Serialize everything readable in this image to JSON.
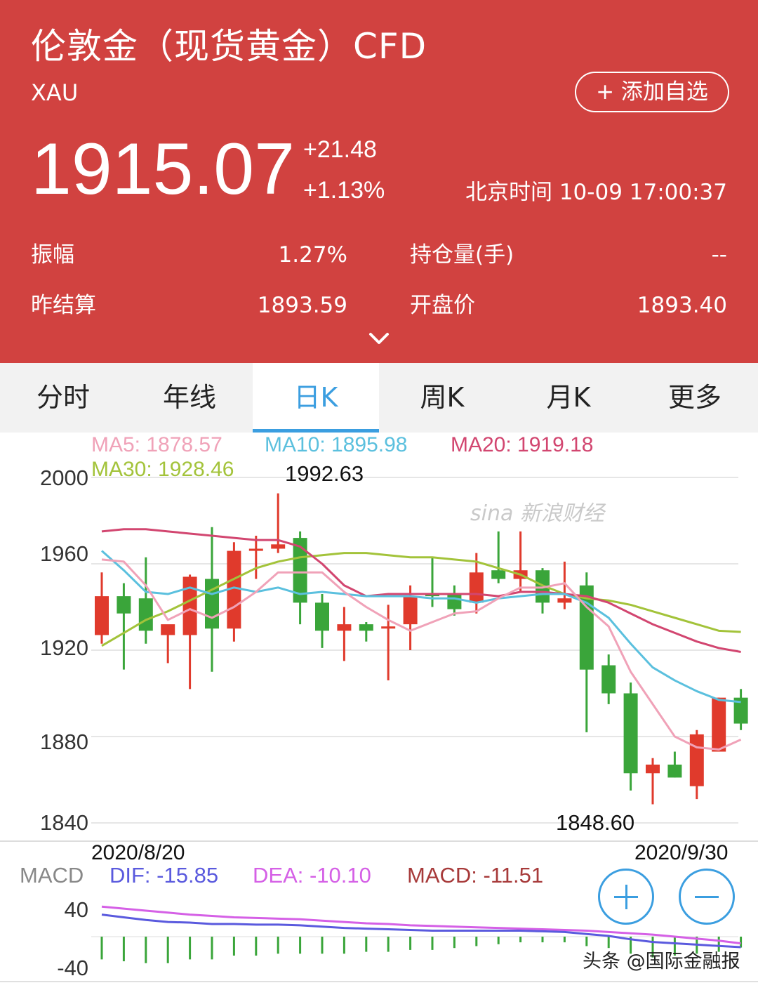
{
  "header": {
    "title": "伦敦金（现货黄金）CFD",
    "code": "XAU",
    "add_button": "+ 添加自选",
    "price": "1915.07",
    "change": "+21.48",
    "change_pct": "+1.13%",
    "time": "北京时间 10-09 17:00:37",
    "stats": {
      "amplitude_label": "振幅",
      "amplitude_value": "1.27%",
      "oi_label": "持仓量(手)",
      "oi_value": "--",
      "prev_settle_label": "昨结算",
      "prev_settle_value": "1893.59",
      "open_label": "开盘价",
      "open_value": "1893.40"
    },
    "expand_icon": "chevron-down-icon"
  },
  "tabs": [
    {
      "label": "分时"
    },
    {
      "label": "年线"
    },
    {
      "label": "日K"
    },
    {
      "label": "周K"
    },
    {
      "label": "月K"
    },
    {
      "label": "更多"
    }
  ],
  "active_tab": "日K",
  "colors": {
    "header_bg": "#d14240",
    "accent": "#3b9ee0",
    "up": "#e03a2c",
    "down": "#3aa53a",
    "ma5": "#f0a2b8",
    "ma10": "#5bc0de",
    "ma20": "#d24670",
    "ma30": "#a3c33a",
    "dif": "#5a5ade",
    "dea": "#d560e6",
    "macd": "#a73a3a"
  },
  "ma_legend": {
    "ma5": "MA5: 1878.57",
    "ma10": "MA10: 1895.98",
    "ma20": "MA20: 1919.18",
    "ma30": "MA30: 1928.46"
  },
  "watermark": "sina 新浪财经",
  "chart_data": {
    "type": "candlestick",
    "y_ticks": [
      "2000",
      "1960",
      "1920",
      "1880",
      "1840"
    ],
    "ylim": [
      1840,
      2000
    ],
    "x_start_label": "2020/8/20",
    "x_end_label": "2020/9/30",
    "high_label": "1992.63",
    "low_label": "1848.60",
    "candles": [
      {
        "o": 1927,
        "h": 1956,
        "l": 1923,
        "c": 1945
      },
      {
        "o": 1945,
        "h": 1951,
        "l": 1911,
        "c": 1937
      },
      {
        "o": 1944,
        "h": 1963,
        "l": 1923,
        "c": 1929
      },
      {
        "o": 1927,
        "h": 1930,
        "l": 1914,
        "c": 1932
      },
      {
        "o": 1927,
        "h": 1955,
        "l": 1902,
        "c": 1954
      },
      {
        "o": 1953,
        "h": 1977,
        "l": 1910,
        "c": 1930
      },
      {
        "o": 1930,
        "h": 1970,
        "l": 1924,
        "c": 1966
      },
      {
        "o": 1966,
        "h": 1973,
        "l": 1953,
        "c": 1967
      },
      {
        "o": 1967,
        "h": 1992.63,
        "l": 1965,
        "c": 1969
      },
      {
        "o": 1972,
        "h": 1975,
        "l": 1932,
        "c": 1942
      },
      {
        "o": 1942,
        "h": 1946,
        "l": 1921,
        "c": 1929
      },
      {
        "o": 1929,
        "h": 1940,
        "l": 1915,
        "c": 1932
      },
      {
        "o": 1932,
        "h": 1933,
        "l": 1924,
        "c": 1929
      },
      {
        "o": 1930,
        "h": 1941,
        "l": 1906,
        "c": 1931
      },
      {
        "o": 1932,
        "h": 1950,
        "l": 1920,
        "c": 1945
      },
      {
        "o": 1946,
        "h": 1963,
        "l": 1940,
        "c": 1945
      },
      {
        "o": 1946,
        "h": 1950,
        "l": 1936,
        "c": 1939
      },
      {
        "o": 1942,
        "h": 1965,
        "l": 1937,
        "c": 1956
      },
      {
        "o": 1957,
        "h": 1975,
        "l": 1951,
        "c": 1953
      },
      {
        "o": 1953,
        "h": 1975,
        "l": 1947,
        "c": 1957
      },
      {
        "o": 1957,
        "h": 1958,
        "l": 1937,
        "c": 1942
      },
      {
        "o": 1942,
        "h": 1961,
        "l": 1939,
        "c": 1944
      },
      {
        "o": 1950,
        "h": 1956,
        "l": 1882,
        "c": 1911
      },
      {
        "o": 1913,
        "h": 1918,
        "l": 1895,
        "c": 1900
      },
      {
        "o": 1900,
        "h": 1905,
        "l": 1855,
        "c": 1863
      },
      {
        "o": 1863,
        "h": 1870,
        "l": 1848.6,
        "c": 1867
      },
      {
        "o": 1867,
        "h": 1873,
        "l": 1861,
        "c": 1861
      },
      {
        "o": 1857,
        "h": 1883,
        "l": 1851,
        "c": 1881
      },
      {
        "o": 1873,
        "h": 1898,
        "l": 1874,
        "c": 1898
      },
      {
        "o": 1898,
        "h": 1902,
        "l": 1883,
        "c": 1886
      }
    ],
    "ma5": [
      1962,
      1961,
      1950,
      1934,
      1939,
      1935,
      1940,
      1947,
      1956,
      1956,
      1956,
      1947,
      1940,
      1934,
      1929,
      1933,
      1937,
      1938,
      1944,
      1949,
      1949,
      1951,
      1940,
      1931,
      1910,
      1895,
      1880,
      1875,
      1874,
      1878.57
    ],
    "ma10": [
      1966,
      1957,
      1947,
      1946,
      1949,
      1946,
      1949,
      1947,
      1949,
      1946,
      1947,
      1946,
      1945,
      1945,
      1945,
      1944,
      1944,
      1942,
      1944,
      1945,
      1946,
      1946,
      1942,
      1935,
      1923,
      1912,
      1906,
      1901,
      1897,
      1895.98
    ],
    "ma20": [
      1975,
      1976,
      1976,
      1975,
      1974,
      1973,
      1972,
      1971,
      1971,
      1968,
      1960,
      1950,
      1945,
      1946,
      1946,
      1946,
      1946,
      1946,
      1945,
      1947,
      1947,
      1946,
      1945,
      1942,
      1937,
      1932,
      1928,
      1924,
      1921,
      1919.18
    ],
    "ma30": [
      1922,
      1928,
      1934,
      1938,
      1943,
      1948,
      1953,
      1958,
      1961,
      1963,
      1964,
      1965,
      1965,
      1964,
      1963,
      1963,
      1962,
      1961,
      1958,
      1955,
      1950,
      1946,
      1944,
      1943,
      1941,
      1938,
      1935,
      1932,
      1929,
      1928.46
    ]
  },
  "macd": {
    "label": "MACD",
    "dif_label": "DIF: -15.85",
    "dea_label": "DEA: -10.10",
    "macd_label": "MACD: -11.51",
    "y_ticks": [
      "40",
      "-40"
    ],
    "dif": [
      33,
      29,
      25,
      22,
      21,
      19,
      19,
      18,
      18,
      17,
      15,
      13,
      12,
      11,
      10,
      9,
      9,
      9,
      9,
      9,
      8,
      7,
      4,
      1,
      -4,
      -8,
      -10,
      -12,
      -14,
      -15.85
    ],
    "dea": [
      45,
      42,
      39,
      36,
      33,
      31,
      29,
      28,
      27,
      26,
      24,
      22,
      20,
      19,
      17,
      16,
      15,
      14,
      13,
      12,
      11,
      10,
      9,
      7,
      5,
      3,
      0,
      -3,
      -6,
      -10.1
    ],
    "hist": [
      -24,
      -26,
      -28,
      -28,
      -24,
      -24,
      -20,
      -20,
      -18,
      -18,
      -18,
      -18,
      -16,
      -16,
      -14,
      -14,
      -12,
      -10,
      -8,
      -6,
      -6,
      -6,
      -10,
      -12,
      -18,
      -22,
      -20,
      -18,
      -16,
      -11.51
    ]
  },
  "zoom_in_icon": "plus-circle-icon",
  "zoom_out_icon": "minus-circle-icon",
  "credit": "头条 @国际金融报"
}
